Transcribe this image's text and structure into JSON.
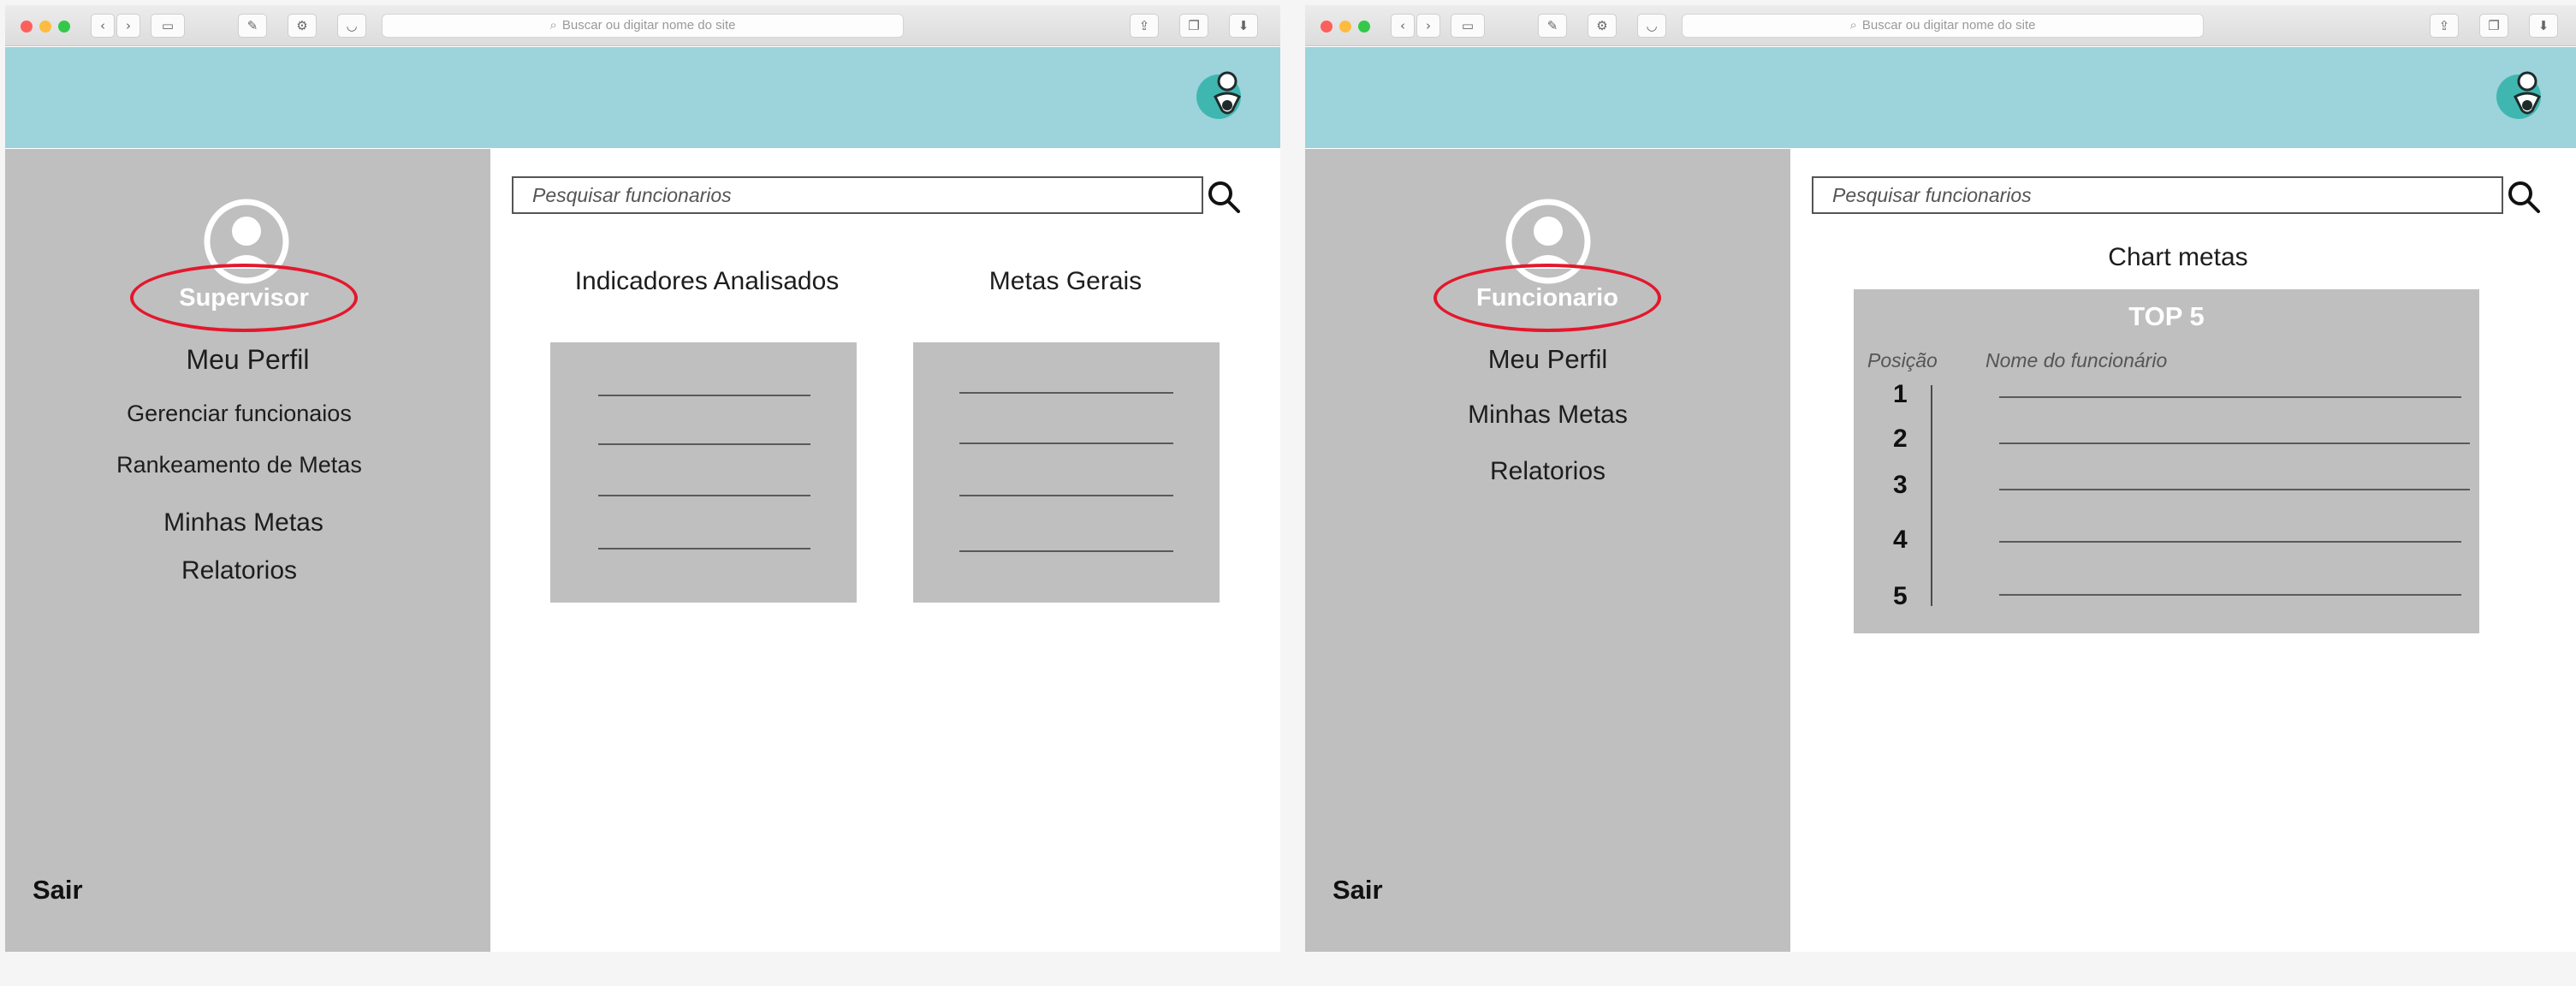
{
  "browser": {
    "address_placeholder": "Buscar ou digitar nome do site"
  },
  "left_screen": {
    "role_label": "Supervisor",
    "menu": [
      "Meu Perfil",
      "Gerenciar funcionaios",
      "Rankeamento de Metas",
      "Minhas Metas",
      "Relatorios"
    ],
    "logout_label": "Sair",
    "search_placeholder": "Pesquisar funcionarios",
    "columns": [
      {
        "title": "Indicadores Analisados"
      },
      {
        "title": "Metas Gerais"
      }
    ]
  },
  "right_screen": {
    "role_label": "Funcionario",
    "menu": [
      "Meu Perfil",
      "Minhas Metas",
      "Relatorios"
    ],
    "logout_label": "Sair",
    "search_placeholder": "Pesquisar funcionarios",
    "chart_heading": "Chart metas",
    "ranking_panel": {
      "title": "TOP 5",
      "col_position": "Posição",
      "col_name": "Nome do funcionário",
      "positions": [
        "1",
        "2",
        "3",
        "4",
        "5"
      ]
    }
  },
  "colors": {
    "header_band": "#9dd3db",
    "sidebar": "#bfbfbf",
    "highlight_ellipse": "#e3182d"
  },
  "icons": [
    "browser-back-icon",
    "browser-forward-icon",
    "sidebar-toggle-icon",
    "share-icon",
    "tabs-icon",
    "download-icon",
    "user-avatar-icon",
    "search-icon",
    "app-logo-icon"
  ]
}
